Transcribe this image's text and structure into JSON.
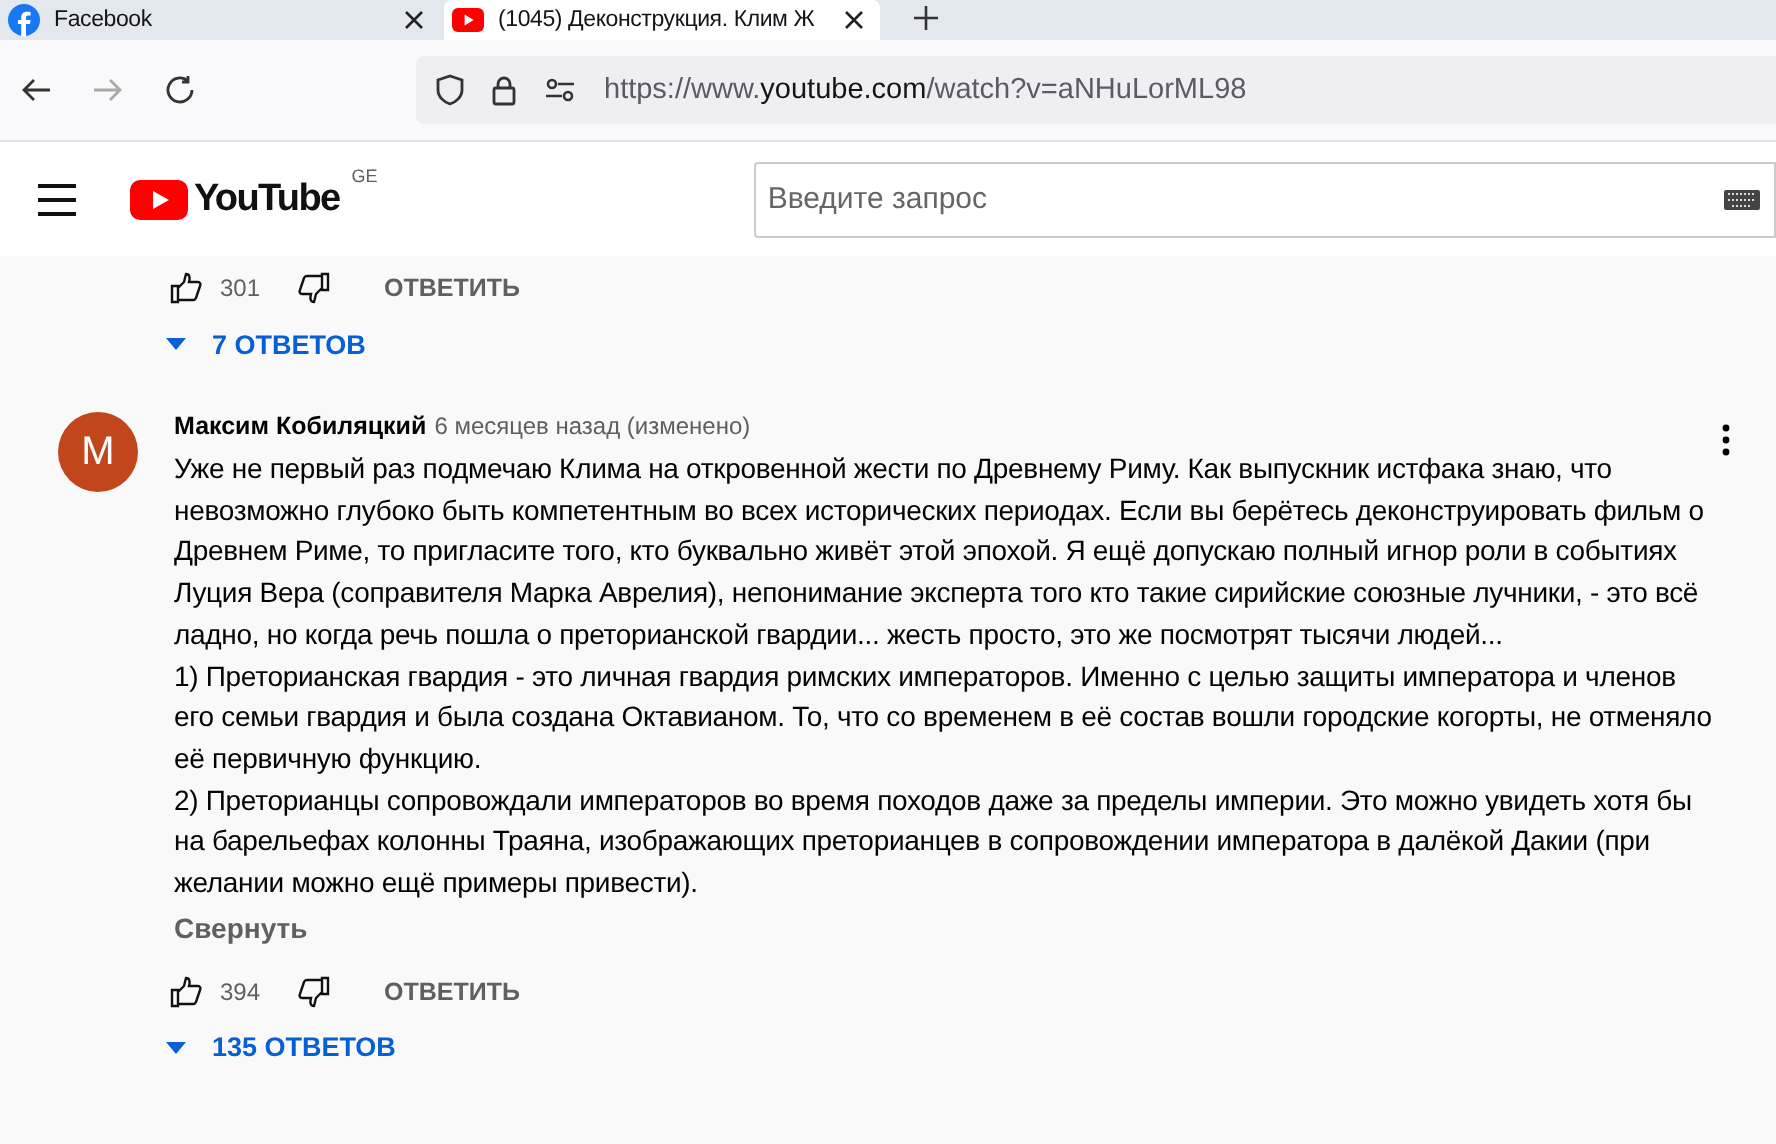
{
  "browser": {
    "tabs": [
      {
        "title": "Facebook",
        "kind": "facebook",
        "selected": false
      },
      {
        "title": "(1045) Деконструкция. Клим Ж",
        "kind": "youtube",
        "selected": true
      }
    ],
    "url": {
      "host_prefix": "https://www.",
      "host": "youtube.com",
      "path": "/watch?v=aNHuLorML98"
    }
  },
  "header": {
    "logo": "YouTube",
    "region": "GE",
    "search": {
      "placeholder": "Введите запрос"
    }
  },
  "previous_comment": {
    "likes": "301",
    "reply": "ОТВЕТИТЬ",
    "replies": "7 ОТВЕТОВ"
  },
  "comment": {
    "avatar": "М",
    "author": "Максим Кобиляцкий",
    "time": "6 месяцев назад (изменено)",
    "paragraphs": [
      "Уже не первый раз подмечаю Клима на откровенной жести по Древнему Риму. Как выпускник истфака знаю, что невозможно глубоко быть компетентным во всех исторических периодах. Если вы берётесь деконструировать фильм о Древнем Риме, то пригласите того, кто буквально живёт этой эпохой. Я ещё допускаю полный игнор роли в событиях Луция Вера (соправителя Марка Аврелия), непонимание эксперта того кто такие сирийские союзные лучники, - это всё ладно, но когда речь пошла о преторианской гвардии... жесть просто, это же посмотрят тысячи людей...",
      "1) Преторианская гвардия - это личная гвардия римских императоров. Именно с целью защиты императора и членов его семьи гвардия и была создана Октавианом. То, что со временем в её состав вошли городские когорты, не отменяло её первичную функцию.",
      "2) Преторианцы сопровождали императоров во время походов даже за пределы империи. Это можно увидеть хотя бы на барельефах колонны Траяна, изображающих преторианцев в сопровождении императора в далёкой Дакии (при желании можно ещё примеры привести)."
    ],
    "collapse": "Свернуть",
    "likes": "394",
    "reply": "ОТВЕТИТЬ",
    "replies": "135 ОТВЕТОВ"
  }
}
